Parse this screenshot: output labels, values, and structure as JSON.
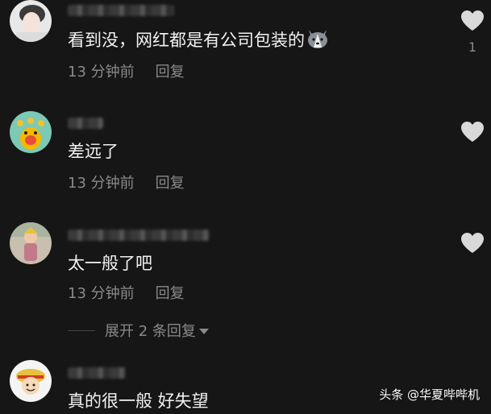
{
  "colors": {
    "background": "#161616",
    "text": "#f2f2f2",
    "meta": "#8a8a8a",
    "heart": "#d9d9d9"
  },
  "comments": [
    {
      "text": "看到没，网红都是有公司包装的",
      "emoji": "husky-face-emoji",
      "time": "13 分钟前",
      "reply": "回复",
      "likes": "1"
    },
    {
      "text": "差远了",
      "time": "13 分钟前",
      "reply": "回复",
      "likes": ""
    },
    {
      "text": "太一般了吧",
      "time": "13 分钟前",
      "reply": "回复",
      "likes": ""
    },
    {
      "text": "真的很一般 好失望",
      "time": "",
      "reply": "",
      "likes": ""
    }
  ],
  "expand_replies": "展开 2 条回复",
  "watermark": "头条 @华夏哔哔机"
}
